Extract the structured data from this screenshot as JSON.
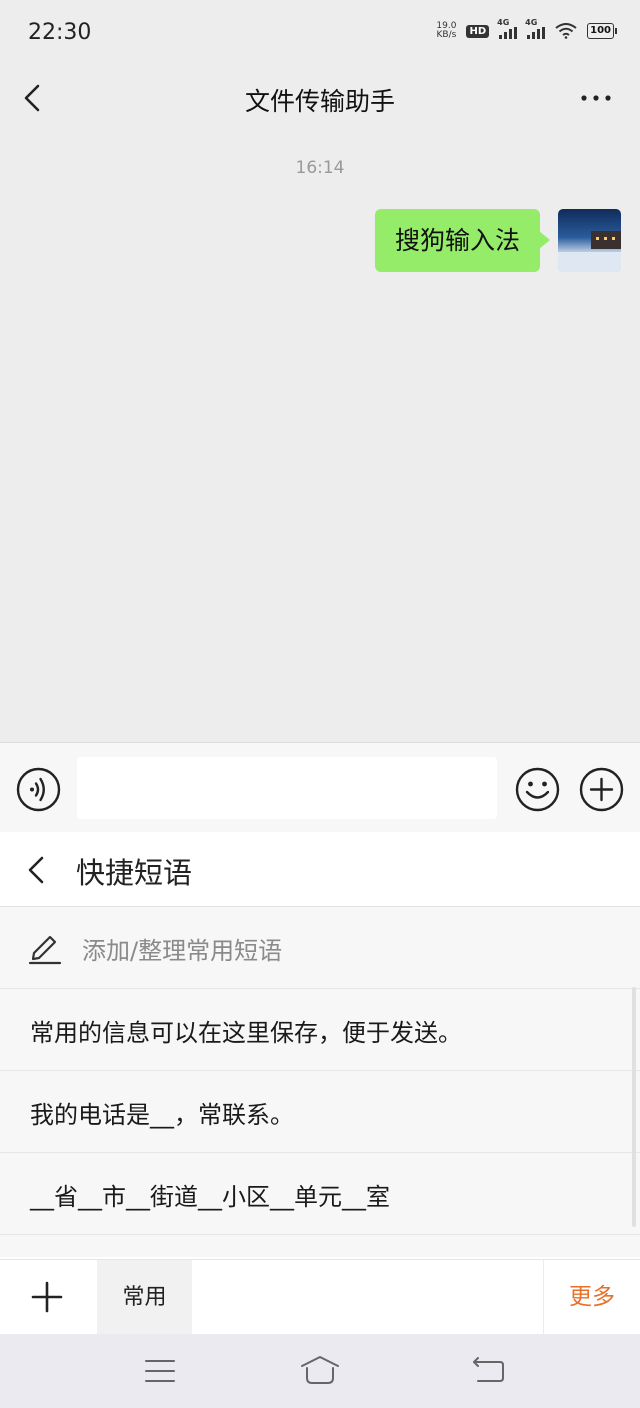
{
  "status_bar": {
    "time": "22:30",
    "net_speed_value": "19.0",
    "net_speed_unit": "KB/s",
    "hd_label": "HD",
    "sim1_label": "4G",
    "sim2_label": "4G",
    "battery": "100"
  },
  "header": {
    "title": "文件传输助手"
  },
  "chat": {
    "timestamp": "16:14",
    "messages": [
      {
        "text": "搜狗输入法",
        "from": "me"
      }
    ]
  },
  "input": {
    "value": "",
    "placeholder": ""
  },
  "quick_phrases": {
    "title": "快捷短语",
    "add_label": "添加/整理常用短语",
    "items": [
      "常用的信息可以在这里保存，便于发送。",
      "我的电话是__，常联系。",
      "__省__市__街道__小区__单元__室"
    ]
  },
  "toolbar": {
    "tab_label": "常用",
    "more_label": "更多"
  },
  "colors": {
    "bubble": "#95ec69",
    "accent_orange": "#e8702a",
    "background": "#ededed"
  }
}
